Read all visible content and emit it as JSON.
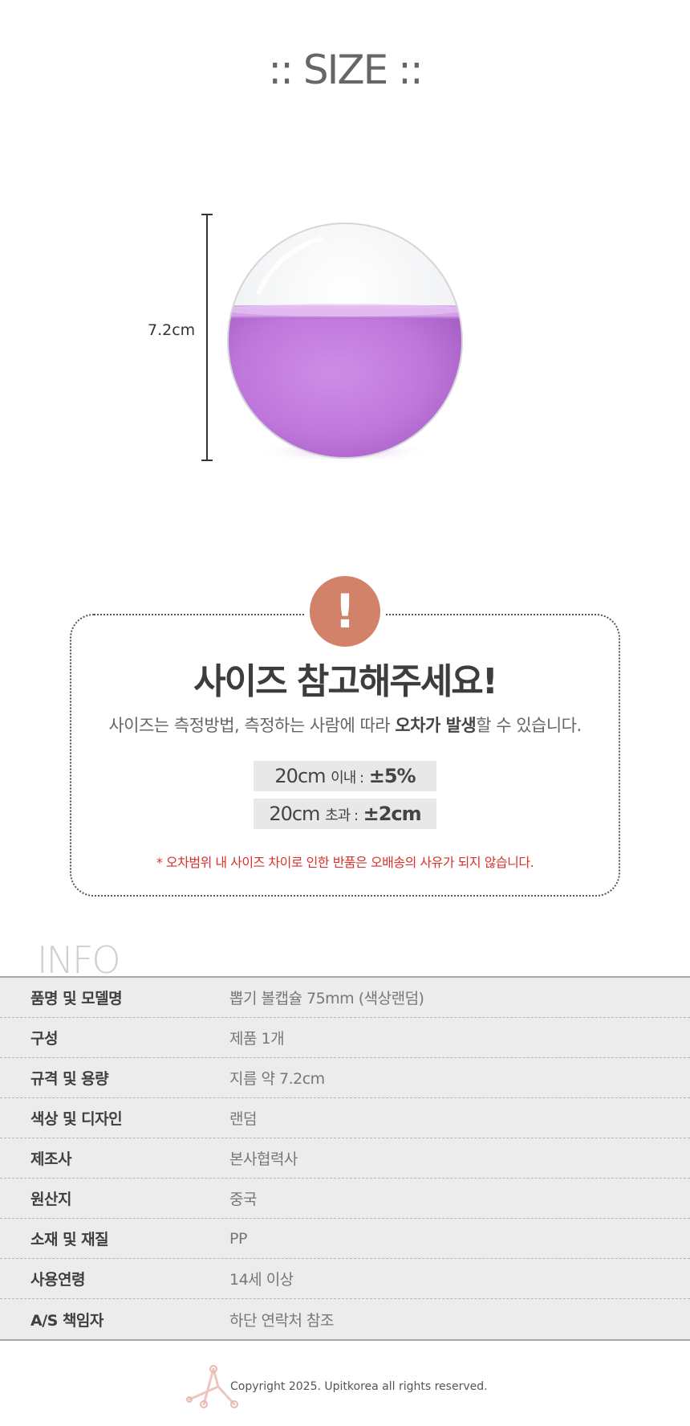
{
  "size_section": {
    "title": ":: SIZE ::",
    "dimension_label": "7.2cm"
  },
  "notice": {
    "icon": "exclamation-icon",
    "icon_text": "!",
    "title": "사이즈 참고해주세요!",
    "desc_before": "사이즈는 측정방법, 측정하는 사람에 따라 ",
    "desc_bold": "오차가 발생",
    "desc_after": "할 수 있습니다.",
    "tolerances": [
      {
        "size": "20cm",
        "qualifier": "이내 :",
        "value": "±5%"
      },
      {
        "size": "20cm",
        "qualifier": "초과 :",
        "value": "±2cm"
      }
    ],
    "warning": "* 오차범위 내 사이즈 차이로 인한 반품은 오배송의 사유가 되지 않습니다."
  },
  "info": {
    "title": "INFO",
    "rows": [
      {
        "label": "품명 및 모델명",
        "value": "뽑기 볼캡슐 75mm (색상랜덤)"
      },
      {
        "label": "구성",
        "value": "제품 1개"
      },
      {
        "label": "규격 및 용량",
        "value": "지름 약 7.2cm"
      },
      {
        "label": "색상 및 디자인",
        "value": "랜덤"
      },
      {
        "label": "제조사",
        "value": "본사협력사"
      },
      {
        "label": "원산지",
        "value": "중국"
      },
      {
        "label": "소재 및 재질",
        "value": "PP"
      },
      {
        "label": "사용연령",
        "value": "14세 이상"
      },
      {
        "label": "A/S 책임자",
        "value": "하단 연락처 참조"
      }
    ]
  },
  "footer": {
    "copyright": "Copyright 2025. Upitkorea all rights reserved."
  },
  "colors": {
    "alert": "#d28268",
    "capsule_purple": "#c77ee0",
    "warning_red": "#d9312b",
    "table_bg": "#ececec"
  }
}
